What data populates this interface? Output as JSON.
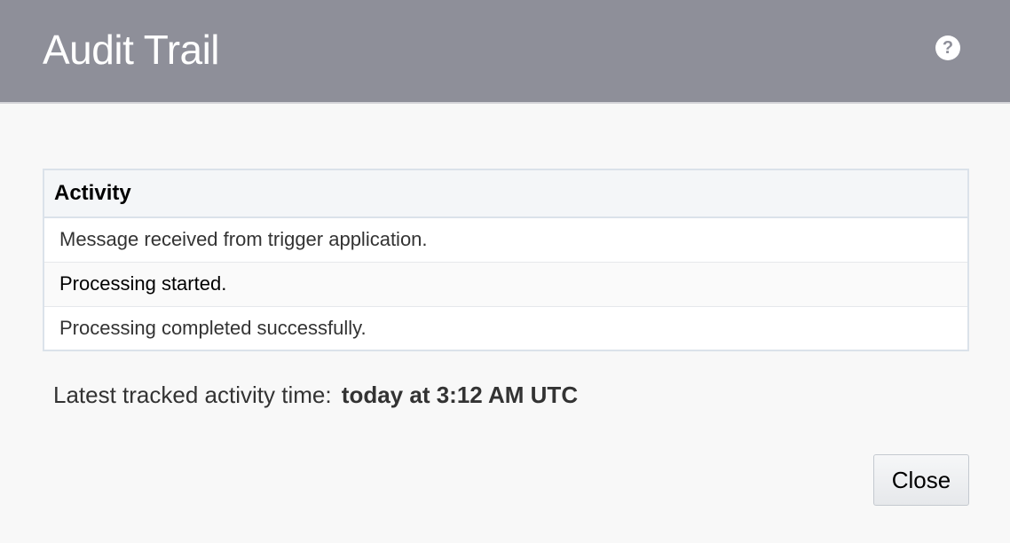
{
  "dialog": {
    "title": "Audit Trail",
    "help_icon": "question-circle-icon"
  },
  "table": {
    "header": "Activity",
    "rows": [
      "Message received from trigger application.",
      "Processing started.",
      "Processing completed successfully."
    ]
  },
  "latest": {
    "label": "Latest tracked activity time:",
    "value": "today at 3:12 AM UTC"
  },
  "footer": {
    "close_label": "Close"
  },
  "colors": {
    "header_bg": "#8e8f99",
    "body_bg": "#f8f8f8",
    "table_border": "#dbe2ea"
  }
}
